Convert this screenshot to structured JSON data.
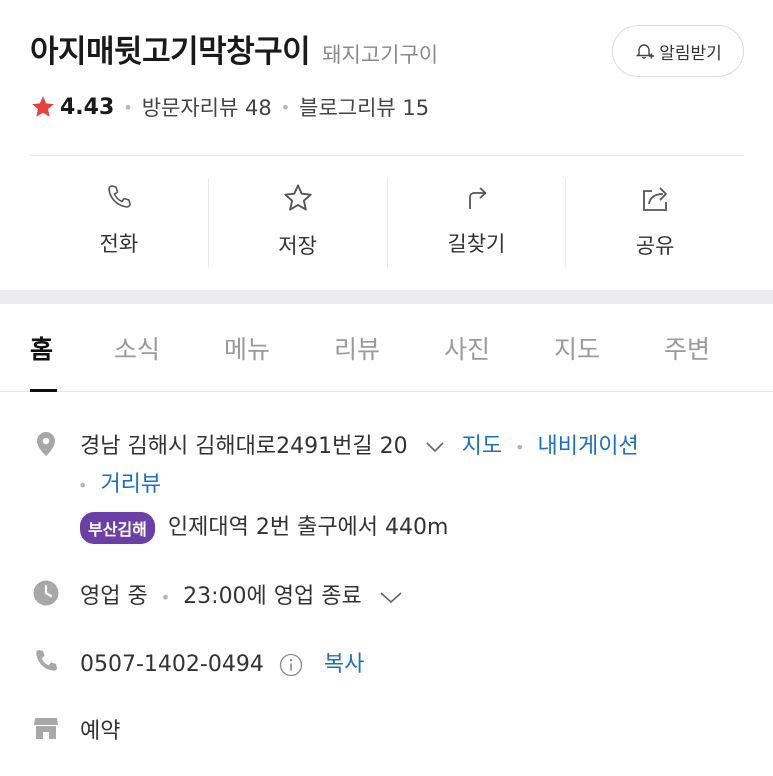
{
  "header": {
    "name": "아지매뒷고기막창구이",
    "category": "돼지고기구이",
    "notify_label": "알림받기"
  },
  "rating": {
    "score": "4.43",
    "visitor_reviews": "방문자리뷰 48",
    "blog_reviews": "블로그리뷰 15"
  },
  "actions": [
    {
      "label": "전화",
      "icon": "phone-icon"
    },
    {
      "label": "저장",
      "icon": "star-outline-icon"
    },
    {
      "label": "길찾기",
      "icon": "directions-icon"
    },
    {
      "label": "공유",
      "icon": "share-icon"
    }
  ],
  "tabs": [
    "홈",
    "소식",
    "메뉴",
    "리뷰",
    "사진",
    "지도",
    "주변"
  ],
  "active_tab": "홈",
  "address": {
    "text": "경남 김해시 김해대로2491번길 20",
    "map_link": "지도",
    "navigation_link": "내비게이션",
    "street_view_link": "거리뷰",
    "line_badge": "부산김해",
    "line_color": "#6c3fa8",
    "subway_info": "인제대역 2번 출구에서 440m"
  },
  "hours": {
    "status": "영업 중",
    "closing": "23:00에 영업 종료"
  },
  "phone": {
    "number": "0507-1402-0494",
    "copy_label": "복사"
  },
  "reservation": {
    "label": "예약"
  },
  "colors": {
    "link": "#1b6fc7",
    "star": "#e8423f",
    "icon_gray": "#a8a8a8"
  }
}
